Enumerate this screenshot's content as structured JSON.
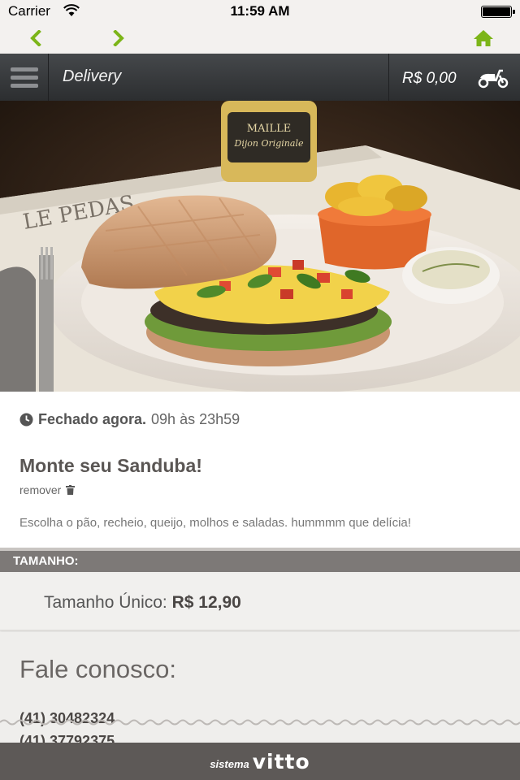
{
  "status_bar": {
    "carrier": "Carrier",
    "time": "11:59 AM",
    "battery": "full"
  },
  "nav": {
    "back_icon": "chevron-left-icon",
    "forward_icon": "chevron-right-icon",
    "home_icon": "home-icon",
    "accent_color": "#7cb518"
  },
  "header": {
    "title": "Delivery",
    "cart_total": "R$ 0,00",
    "cart_icon": "scooter-icon"
  },
  "product": {
    "hours_status": "Fechado agora.",
    "hours_range": "09h às 23h59",
    "title": "Monte seu Sanduba!",
    "remove_label": "remover",
    "description": "Escolha o pão, recheio, queijo, molhos e saladas. hummmm que delícia!"
  },
  "sizes": {
    "header": "TAMANHO:",
    "options": [
      {
        "label": "Tamanho Único:",
        "price": "R$ 12,90"
      }
    ]
  },
  "contact": {
    "title": "Fale conosco:",
    "phones": [
      "(41) 30482324",
      "(41) 37792375"
    ]
  },
  "footer": {
    "prefix": "sistema",
    "brand": "vitto"
  }
}
